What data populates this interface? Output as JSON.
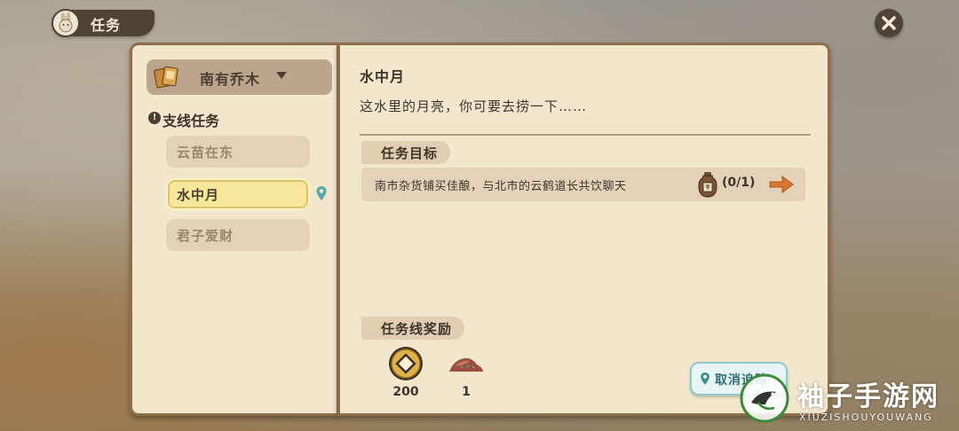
{
  "header": {
    "title": "任务",
    "icon": "rabbit-icon",
    "close_icon": "close-icon"
  },
  "sidebar": {
    "character_name": "南有乔木",
    "character_icon": "cards-icon",
    "category_label": "支线任务",
    "quests": [
      {
        "label": "云苗在东",
        "active": false
      },
      {
        "label": "水中月",
        "active": true,
        "tracked": true
      },
      {
        "label": "君子爱财",
        "active": false
      }
    ]
  },
  "quest": {
    "title": "水中月",
    "description": "这水里的月亮，你可要去捞一下……",
    "objective_section": "任务目标",
    "objective": {
      "text": "南市杂货铺买佳酿，与北市的云鹤道长共饮聊天",
      "item_icon": "wine-jar-icon",
      "progress": "(0/1)",
      "go_icon": "arrow-right-icon"
    },
    "reward_section": "任务线奖励",
    "rewards": [
      {
        "icon": "copper-coin-icon",
        "qty": "200"
      },
      {
        "icon": "soil-pile-icon",
        "qty": "1"
      }
    ],
    "cancel_track_label": "取消追踪"
  },
  "watermark": {
    "text": "袖子手游网",
    "subtext": "XIUZISHOUYOUWANG"
  },
  "colors": {
    "paper": "#f2e6cd",
    "border": "#8e6f4d",
    "active_quest": "#f7e79a",
    "accent_orange": "#d9782e",
    "track_teal": "#2f6f73"
  }
}
